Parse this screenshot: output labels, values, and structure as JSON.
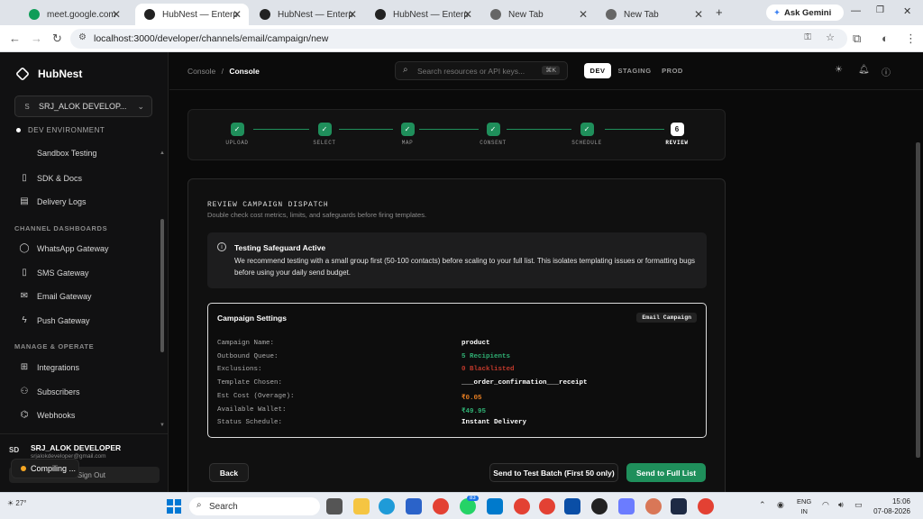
{
  "browser": {
    "tabs": [
      {
        "title": "meet.google.com",
        "icon_color": "#0f9d58"
      },
      {
        "title": "HubNest — Enterprise",
        "icon_color": "#222222"
      },
      {
        "title": "HubNest — Enterprise",
        "icon_color": "#222222"
      },
      {
        "title": "HubNest — Enterprise",
        "icon_color": "#222222"
      },
      {
        "title": "New Tab",
        "icon_color": "#666666"
      },
      {
        "title": "New Tab",
        "icon_color": "#666666"
      }
    ],
    "new_tab": "+",
    "gemini": "Ask Gemini",
    "url": "localhost:3000/developer/channels/email/campaign/new"
  },
  "sidebar": {
    "brand": "HubNest",
    "account": {
      "initial": "S",
      "name": "SRJ_ALOK DEVELOP..."
    },
    "environment": "DEV ENVIRONMENT",
    "items_top": [
      {
        "label": "Sandbox Testing",
        "icon": "flask-icon"
      },
      {
        "label": "SDK & Docs",
        "icon": "book-icon"
      },
      {
        "label": "Delivery Logs",
        "icon": "log-icon"
      }
    ],
    "section_channels": "CHANNEL DASHBOARDS",
    "channels": [
      {
        "label": "WhatsApp Gateway",
        "icon": "whatsapp-icon"
      },
      {
        "label": "SMS Gateway",
        "icon": "phone-icon"
      },
      {
        "label": "Email Gateway",
        "icon": "mail-icon"
      },
      {
        "label": "Push Gateway",
        "icon": "bolt-icon"
      }
    ],
    "section_manage": "MANAGE & OPERATE",
    "manage": [
      {
        "label": "Integrations",
        "icon": "grid-icon"
      },
      {
        "label": "Subscribers",
        "icon": "user-icon"
      },
      {
        "label": "Webhooks",
        "icon": "webhook-icon"
      }
    ],
    "user": {
      "initials": "SD",
      "name": "SRJ_ALOK DEVELOPER",
      "email": "srjalokdeveloper@gmail.com"
    },
    "sign_out": "Sign Out",
    "compiling": "Compiling ..."
  },
  "header": {
    "breadcrumb_parent": "Console",
    "breadcrumb_current": "Console",
    "search_placeholder": "Search resources or API keys...",
    "search_kbd": "⌘K",
    "env_tabs": [
      "DEV",
      "STAGING",
      "PROD"
    ],
    "active_env": "DEV"
  },
  "stepper": {
    "steps": [
      {
        "label": "UPLOAD",
        "mark": "✓"
      },
      {
        "label": "SELECT",
        "mark": "✓"
      },
      {
        "label": "MAP",
        "mark": "✓"
      },
      {
        "label": "CONSENT",
        "mark": "✓"
      },
      {
        "label": "SCHEDULE",
        "mark": "✓"
      },
      {
        "label": "REVIEW",
        "mark": "6"
      }
    ]
  },
  "review": {
    "title": "REVIEW CAMPAIGN DISPATCH",
    "subtitle": "Double check cost metrics, limits, and safeguards before firing templates.",
    "alert": {
      "title": "Testing Safeguard Active",
      "body": "We recommend testing with a small group first (50-100 contacts) before scaling to your full list. This isolates templating issues or formatting bugs before using your daily send budget."
    },
    "settings": {
      "title": "Campaign Settings",
      "badge": "Email Campaign",
      "rows": [
        {
          "key": "Campaign Name:",
          "value": "product",
          "color": "#ffffff"
        },
        {
          "key": "Outbound Queue:",
          "value": "5 Recipients",
          "color": "#2fae72"
        },
        {
          "key": "Exclusions:",
          "value": "0 Blacklisted",
          "color": "#c0392b"
        },
        {
          "key": "Template Chosen:",
          "value": "___order_confirmation___receipt",
          "color": "#ffffff"
        },
        {
          "key": "Est Cost (Overage):",
          "value": "₹0.05",
          "color": "#e67e22"
        },
        {
          "key": "Available Wallet:",
          "value": "₹49.95",
          "color": "#2fae72"
        },
        {
          "key": "Status Schedule:",
          "value": "Instant Delivery",
          "color": "#ffffff"
        }
      ]
    },
    "buttons": {
      "back": "Back",
      "test": "Send to Test Batch (First 50 only)",
      "full": "Send to Full List"
    }
  },
  "taskbar": {
    "weather": "27°",
    "search": "Search",
    "lang1": "ENG",
    "lang2": "IN",
    "time": "15:06",
    "date": "07-08-2026",
    "badge": "83"
  }
}
